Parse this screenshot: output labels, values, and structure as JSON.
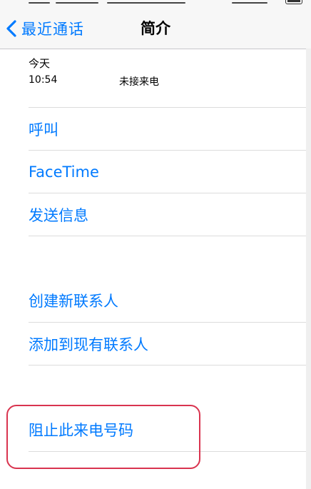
{
  "nav": {
    "back_label": "最近通话",
    "title": "简介"
  },
  "call_history": {
    "day": "今天",
    "entries": [
      {
        "time": "10:54",
        "type": "未接来电"
      }
    ]
  },
  "actions_group_1": [
    {
      "label": "呼叫"
    },
    {
      "label": "FaceTime"
    },
    {
      "label": "发送信息"
    }
  ],
  "actions_group_2": [
    {
      "label": "创建新联系人"
    },
    {
      "label": "添加到现有联系人"
    }
  ],
  "actions_group_3": [
    {
      "label": "阻止此来电号码"
    }
  ],
  "accent_color": "#007aff",
  "highlight_color": "#d9344f",
  "icons": {
    "back": "chevron-left-icon",
    "battery": "battery-icon"
  }
}
